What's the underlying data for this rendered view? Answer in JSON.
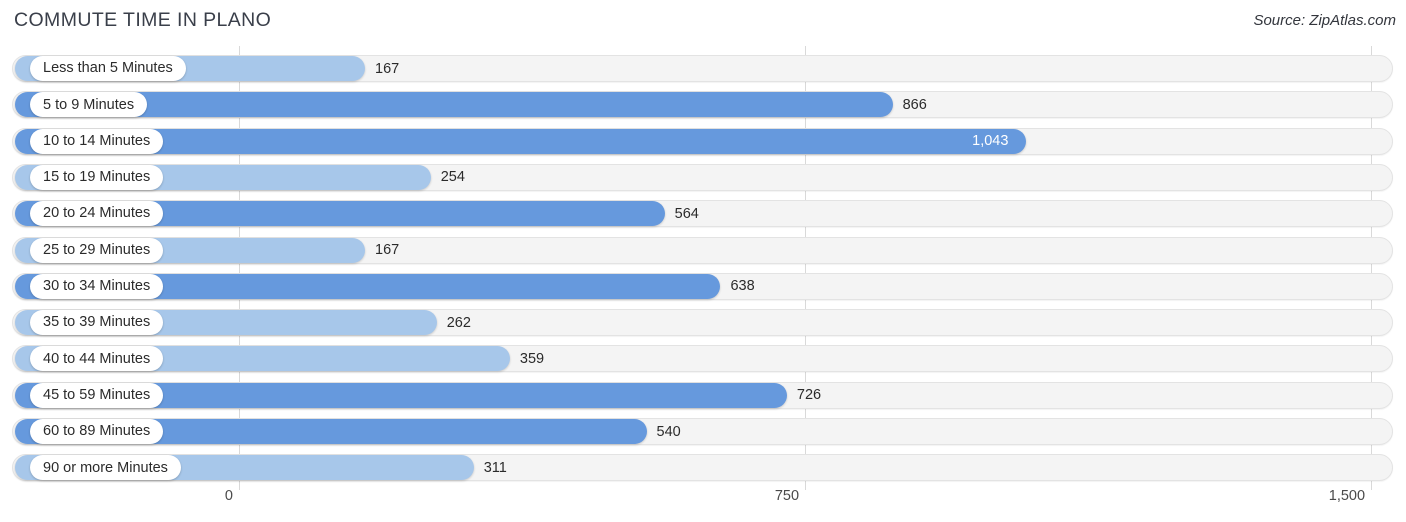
{
  "header": {
    "title": "COMMUTE TIME IN PLANO",
    "source": "Source: ZipAtlas.com"
  },
  "colors": {
    "bar_light": "#a7c7ea",
    "bar_dark": "#6699dd",
    "track": "#f4f4f4",
    "gridline": "#d9d9d9",
    "text": "#2b2b2b",
    "value_inside_text": "#ffffff"
  },
  "chart_data": {
    "type": "bar",
    "orientation": "horizontal",
    "title": "COMMUTE TIME IN PLANO",
    "xlabel": "",
    "ylabel": "",
    "xlim": [
      0,
      1500
    ],
    "grid": true,
    "legend": null,
    "axis_ticks": [
      {
        "label": "0",
        "value": 0
      },
      {
        "label": "750",
        "value": 750
      },
      {
        "label": "1,500",
        "value": 1500
      }
    ],
    "categories": [
      "Less than 5 Minutes",
      "5 to 9 Minutes",
      "10 to 14 Minutes",
      "15 to 19 Minutes",
      "20 to 24 Minutes",
      "25 to 29 Minutes",
      "30 to 34 Minutes",
      "35 to 39 Minutes",
      "40 to 44 Minutes",
      "45 to 59 Minutes",
      "60 to 89 Minutes",
      "90 or more Minutes"
    ],
    "values": [
      167,
      866,
      1043,
      254,
      564,
      167,
      638,
      262,
      359,
      726,
      540,
      311
    ],
    "value_labels": [
      "167",
      "866",
      "1,043",
      "254",
      "564",
      "167",
      "638",
      "262",
      "359",
      "726",
      "540",
      "311"
    ]
  },
  "rows": [
    {
      "label": "Less than 5 Minutes",
      "value": 167,
      "value_label": "167",
      "shade": "light",
      "value_inside": false
    },
    {
      "label": "5 to 9 Minutes",
      "value": 866,
      "value_label": "866",
      "shade": "dark",
      "value_inside": false
    },
    {
      "label": "10 to 14 Minutes",
      "value": 1043,
      "value_label": "1,043",
      "shade": "dark",
      "value_inside": true
    },
    {
      "label": "15 to 19 Minutes",
      "value": 254,
      "value_label": "254",
      "shade": "light",
      "value_inside": false
    },
    {
      "label": "20 to 24 Minutes",
      "value": 564,
      "value_label": "564",
      "shade": "dark",
      "value_inside": false
    },
    {
      "label": "25 to 29 Minutes",
      "value": 167,
      "value_label": "167",
      "shade": "light",
      "value_inside": false
    },
    {
      "label": "30 to 34 Minutes",
      "value": 638,
      "value_label": "638",
      "shade": "dark",
      "value_inside": false
    },
    {
      "label": "35 to 39 Minutes",
      "value": 262,
      "value_label": "262",
      "shade": "light",
      "value_inside": false
    },
    {
      "label": "40 to 44 Minutes",
      "value": 359,
      "value_label": "359",
      "shade": "light",
      "value_inside": false
    },
    {
      "label": "45 to 59 Minutes",
      "value": 726,
      "value_label": "726",
      "shade": "dark",
      "value_inside": false
    },
    {
      "label": "60 to 89 Minutes",
      "value": 540,
      "value_label": "540",
      "shade": "dark",
      "value_inside": false
    },
    {
      "label": "90 or more Minutes",
      "value": 311,
      "value_label": "311",
      "shade": "light",
      "value_inside": false
    }
  ]
}
